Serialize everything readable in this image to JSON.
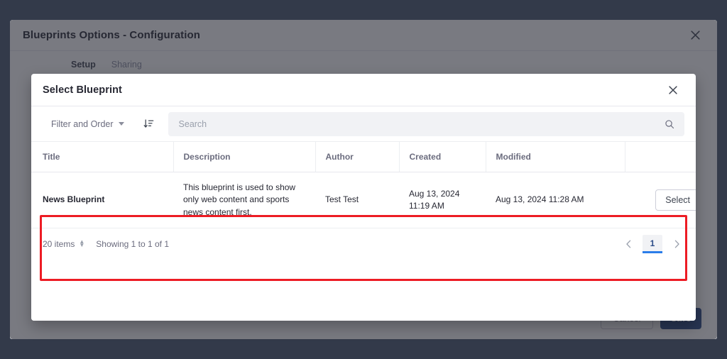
{
  "background_window": {
    "title": "Blueprints Options - Configuration",
    "close_icon": "close-icon",
    "tabs": [
      {
        "label": "Setup",
        "active": true
      },
      {
        "label": "Sharing",
        "active": false
      }
    ],
    "footer": {
      "cancel_label": "Cancel",
      "save_label": "Save"
    }
  },
  "modal": {
    "title": "Select Blueprint",
    "close_icon": "close-icon",
    "management_bar": {
      "filter_label": "Filter and Order",
      "filter_caret_icon": "chevron-down-icon",
      "sort_icon": "sort-descending-icon",
      "search_placeholder": "Search",
      "search_value": "",
      "search_icon": "search-icon"
    },
    "table": {
      "columns": [
        "Title",
        "Description",
        "Author",
        "Created",
        "Modified",
        ""
      ],
      "rows": [
        {
          "title": "News Blueprint",
          "description": "This blueprint is used to show only web content and sports news content first.",
          "author": "Test Test",
          "created": "Aug 13, 2024 11:19 AM",
          "modified": "Aug 13, 2024 11:28 AM",
          "action_label": "Select"
        }
      ]
    },
    "pagination": {
      "items_per_page": "20 items",
      "items_caret_icon": "up-down-caret-icon",
      "showing": "Showing 1 to 1 of 1",
      "prev_icon": "chevron-left-icon",
      "next_icon": "chevron-right-icon",
      "current_page": "1"
    }
  },
  "annotation": {
    "highlight_color": "#ed1c24"
  }
}
